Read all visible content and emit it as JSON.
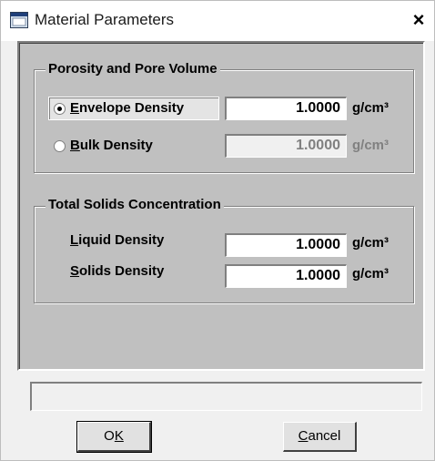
{
  "window": {
    "title": "Material Parameters",
    "close_glyph": "×"
  },
  "porosity_group": {
    "title": "Porosity and Pore Volume",
    "envelope": {
      "label_prefix": "",
      "label_hotkey": "E",
      "label_rest": "nvelope Density",
      "selected": true,
      "value": "1.0000",
      "unit": "g/cm³"
    },
    "bulk": {
      "label_hotkey": "B",
      "label_rest": "ulk Density",
      "selected": false,
      "value": "1.0000",
      "unit": "g/cm³",
      "enabled": false
    }
  },
  "solids_group": {
    "title": "Total Solids Concentration",
    "liquid": {
      "label_hotkey": "L",
      "label_rest": "iquid Density",
      "value": "1.0000",
      "unit": "g/cm³"
    },
    "solids": {
      "label_hotkey": "S",
      "label_rest": "olids Density",
      "value": "1.0000",
      "unit": "g/cm³"
    }
  },
  "status_text": "",
  "buttons": {
    "ok": {
      "hotkey_pre": "O",
      "hotkey": "K",
      "post": ""
    },
    "cancel": {
      "hotkey": "C",
      "rest": "ancel"
    }
  }
}
